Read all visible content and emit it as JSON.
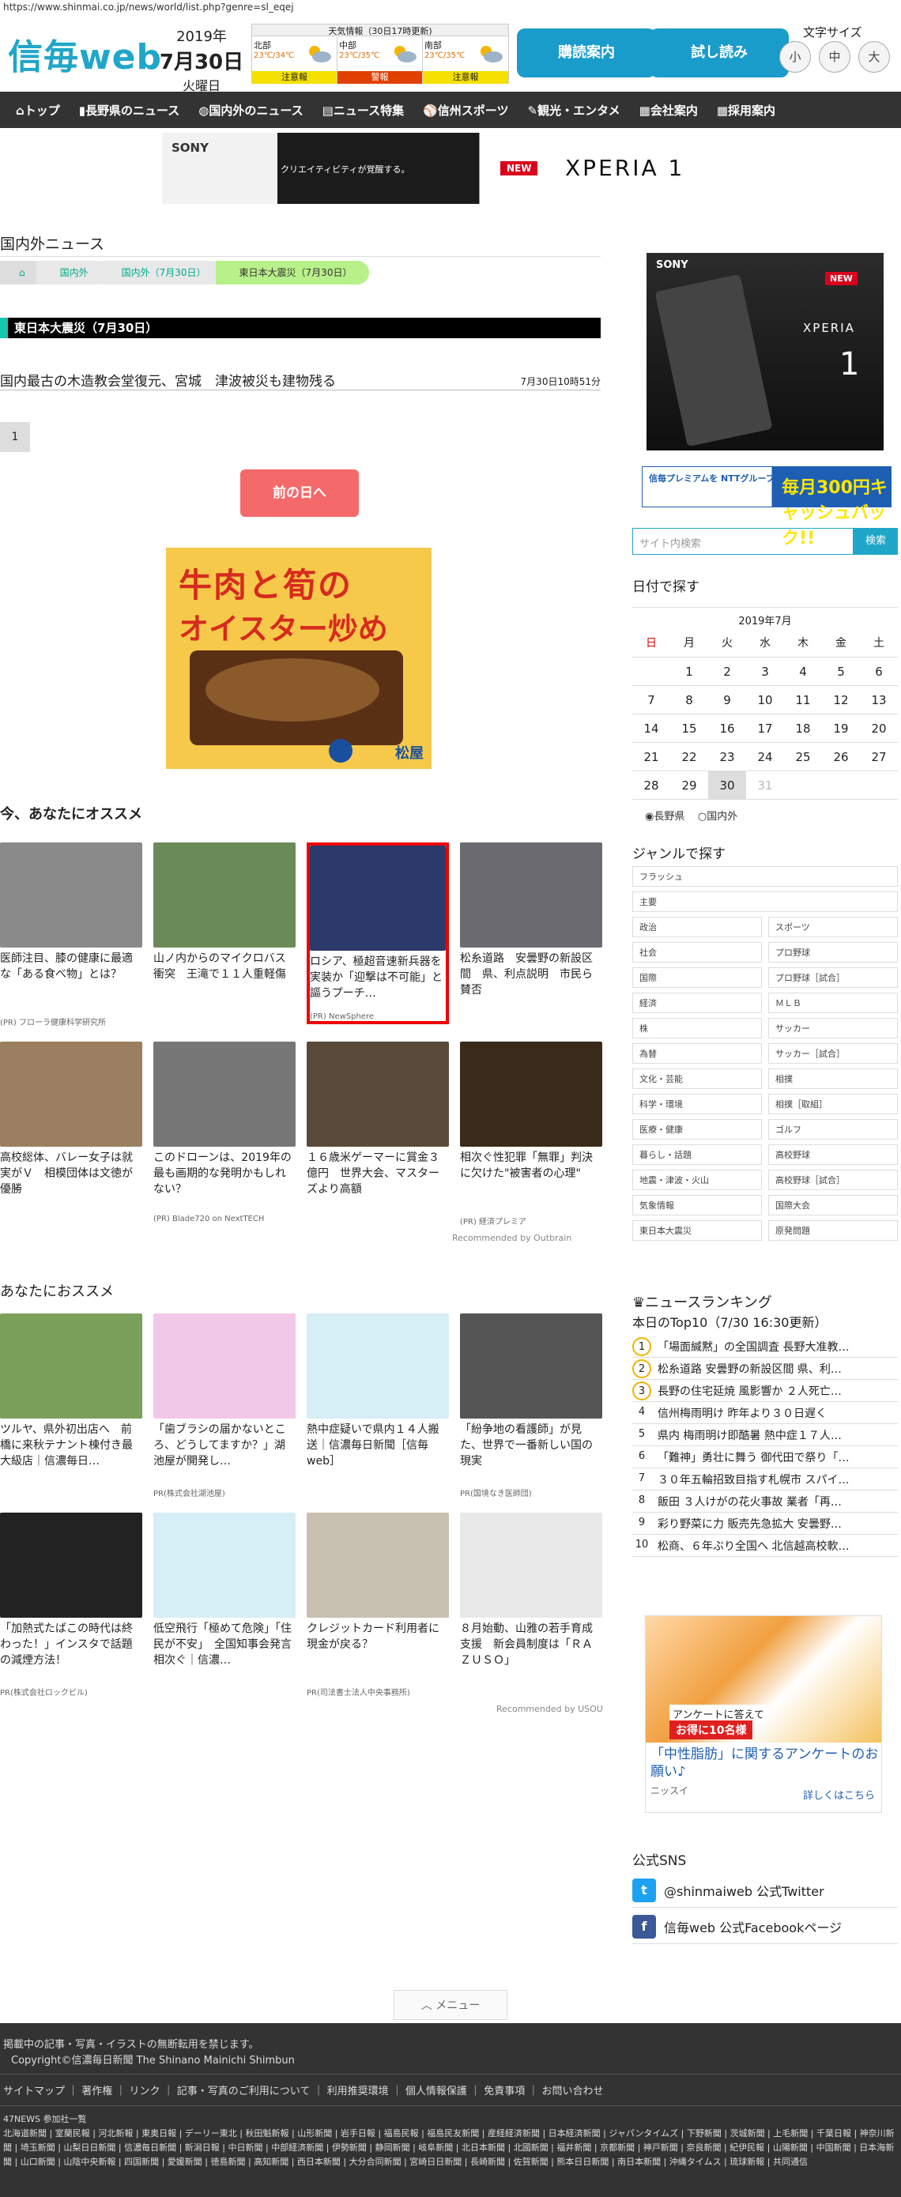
{
  "url": "https://www.shinmai.co.jp/news/world/list.php?genre=sl_eqej",
  "logo": "信毎web",
  "date": {
    "year": "2019年",
    "day": "7月30日",
    "weekday": "火曜日"
  },
  "weather": {
    "title": "天気情報（30日17時更新)",
    "regions": [
      {
        "name": "北部",
        "temp": "23℃/34℃",
        "warn": "注意報",
        "warn_color": "#f5e000"
      },
      {
        "name": "中部",
        "temp": "23℃/35℃",
        "warn": "警報",
        "warn_color": "#e04000"
      },
      {
        "name": "南部",
        "temp": "23℃/35℃",
        "warn": "注意報",
        "warn_color": "#f5e000"
      }
    ]
  },
  "header": {
    "subscribe": "購読案内",
    "trial": "試し読み",
    "font_size_label": "文字サイズ",
    "font_sizes": [
      "小",
      "中",
      "大"
    ]
  },
  "nav": [
    "トップ",
    "長野県のニュース",
    "国内外のニュース",
    "ニュース特集",
    "信州スポーツ",
    "観光・エンタメ",
    "会社案内",
    "採用案内"
  ],
  "top_ad": {
    "brand": "SONY",
    "copy": "クリエイティビティが覚醒する。",
    "badge": "NEW",
    "product": "XPERIA 1"
  },
  "main": {
    "section_title": "国内外ニュース",
    "breadcrumbs": [
      "国内外",
      "国内外（7月30日）",
      "東日本大震災（7月30日）"
    ],
    "date_band": "東日本大震災（7月30日）",
    "article": {
      "title": "国内最古の木造教会堂復元、宮城　津波被災も建物残る",
      "time": "7月30日10時51分"
    },
    "page": "1",
    "prev_day": "前の日へ"
  },
  "food_ad": {
    "line1": "牛肉と筍の",
    "line2": "オイスター炒め",
    "brand": "松屋"
  },
  "rec1": {
    "title": "今、あなたにオススメ",
    "credit": "Recommended by Outbrain",
    "items": [
      {
        "caption": "医師注目、膝の健康に最適な「ある食べ物」とは？",
        "source": "(PR) フローラ健康科学研究所",
        "color": "#8a8a8a"
      },
      {
        "caption": "山ノ内からのマイクロバス衝突　王滝で１１人重軽傷",
        "source": "",
        "color": "#6b8a5a"
      },
      {
        "caption": "ロシア、極超音速新兵器を実装か「迎撃は不可能」と謳うプーチ…",
        "source": "(PR) NewSphere",
        "color": "#2b3a6b"
      },
      {
        "caption": "松糸道路　安曇野の新設区間　県、利点説明　市民ら賛否",
        "source": "",
        "color": "#6a6a70"
      },
      {
        "caption": "高校総体、バレー女子は就実がＶ　相模団体は文徳が優勝",
        "source": "",
        "color": "#9a8060"
      },
      {
        "caption": "このドローンは、2019年の最も画期的な発明かもしれない？",
        "source": "(PR) Blade720 on NextTECH",
        "color": "#777"
      },
      {
        "caption": "１６歳米ゲーマーに賞金３億円　世界大会、マスターズより高額",
        "source": "",
        "color": "#5a4a3a"
      },
      {
        "caption": "相次ぐ性犯罪「無罪」判決に欠けた\"被害者の心理\"",
        "source": "(PR) 経済プレミア",
        "color": "#3a2a1a"
      }
    ]
  },
  "rec2": {
    "title": "あなたにおススメ",
    "credit": "Recommended by USOU",
    "items": [
      {
        "caption": "ツルヤ、県外初出店へ　前橋に来秋テナント棟付き最大級店｜信濃毎日…",
        "source": "",
        "color": "#7aa05a"
      },
      {
        "caption": "「歯ブラシの届かないところ、どうしてますか？」湖池屋が開発し…",
        "source": "PR(株式会社湖池屋)",
        "color": "#f2c8e8"
      },
      {
        "caption": "熱中症疑いで県内１４人搬送｜信濃毎日新聞［信毎web］",
        "source": "",
        "color": "#d6eef5"
      },
      {
        "caption": "「紛争地の看護師」が見た、世界で一番新しい国の現実",
        "source": "PR(国境なき医師団)",
        "color": "#555"
      },
      {
        "caption": "「加熱式たばこの時代は終わった！」インスタで話題の減煙方法！",
        "source": "PR(株式会社ロックビル)",
        "color": "#222"
      },
      {
        "caption": "低空飛行「極めて危険」「住民が不安」　全国知事会発言相次ぐ｜信濃…",
        "source": "",
        "color": "#d6eef5"
      },
      {
        "caption": "クレジットカード利用者に現金が戻る？",
        "source": "PR(司法書士法人中央事務所)",
        "color": "#c8c0b0"
      },
      {
        "caption": "８月始動、山雅の若手育成支援　新会員制度は「ＲＡＺＵＳＯ」",
        "source": "",
        "color": "#e8e8e8"
      }
    ]
  },
  "sidebar": {
    "ad": {
      "brand": "SONY",
      "badge": "NEW",
      "product": "XPERIA",
      "num": "1"
    },
    "premium": {
      "left": "信毎プレミアムを NTTグループカードで お支払いすると",
      "right": "毎月300円キャッシュバック!!"
    },
    "search_placeholder": "サイト内検索",
    "search_button": "検索",
    "calendar_title": "日付で探す",
    "calendar_month": "2019年7月",
    "weekdays": [
      "日",
      "月",
      "火",
      "水",
      "木",
      "金",
      "土"
    ],
    "days": [
      "",
      "1",
      "2",
      "3",
      "4",
      "5",
      "6",
      "7",
      "8",
      "9",
      "10",
      "11",
      "12",
      "13",
      "14",
      "15",
      "16",
      "17",
      "18",
      "19",
      "20",
      "21",
      "22",
      "23",
      "24",
      "25",
      "26",
      "27",
      "28",
      "29",
      "30",
      "31",
      "",
      "",
      ""
    ],
    "radio": [
      "長野県",
      "国内外"
    ],
    "genre_title": "ジャンルで探す",
    "genres_full": [
      "フラッシュ",
      "主要"
    ],
    "genres": [
      "政治",
      "スポーツ",
      "社会",
      "プロ野球",
      "国際",
      "プロ野球［試合］",
      "経済",
      "ＭＬＢ",
      "株",
      "サッカー",
      "為替",
      "サッカー［試合］",
      "文化・芸能",
      "相撲",
      "科学・環境",
      "相撲［取組］",
      "医療・健康",
      "ゴルフ",
      "暮らし・話題",
      "高校野球",
      "地震・津波・火山",
      "高校野球［試合］",
      "気象情報",
      "国際大会",
      "東日本大震災",
      "原発問題"
    ],
    "ranking_title": "ニュースランキング",
    "ranking_sub": "本日のTop10（7/30 16:30更新）",
    "ranking": [
      "「場面緘黙」の全国調査 長野大准教…",
      "松糸道路 安曇野の新設区間 県、利…",
      "長野の住宅延焼 風影響か ２人死亡…",
      "信州梅雨明け 昨年より３０日遅く",
      "県内 梅雨明け即酷暑 熱中症１７人…",
      "「難神」勇壮に舞う 御代田で祭り「…",
      "３０年五輪招致目指す札幌市 スパイ…",
      "飯田 ３人けがの花火事故 業者「再…",
      "彩り野菜に力 販売先急拡大 安曇野…",
      "松商、６年ぶり全国へ 北信越高校軟…"
    ],
    "anketo": {
      "mini": "アンケートに答えて",
      "badge": "お得に10名様",
      "headline": "「中性脂肪」に関するアンケートのお願い♪",
      "sponsor": "ニッスイ",
      "link": "詳しくはこちら"
    },
    "sns_title": "公式SNS",
    "twitter": "@shinmaiweb 公式Twitter",
    "facebook": "信毎web 公式Facebookページ"
  },
  "menu": "メニュー",
  "footer": {
    "notice": "掲載中の記事・写真・イラストの無断転用を禁じます。",
    "copyright": "Copyright©信濃毎日新聞 The Shinano Mainichi Shimbun",
    "links": "サイトマップ ｜ 著作権 ｜ リンク ｜ 記事・写真のご利用について ｜ 利用推奨環境 ｜ 個人情報保護 ｜ 免責事項 ｜ お問い合わせ",
    "members": "47NEWS 参加社一覧\n北海道新聞 | 室蘭民報 | 河北新報 | 東奥日報 | デーリー東北 | 秋田魁新報 | 山形新聞 | 岩手日報 | 福島民報 | 福島民友新聞 | 産経経済新聞 | 日本経済新聞 | ジャパンタイムズ | 下野新聞 | 茨城新聞 | 上毛新聞 | 千葉日報 | 神奈川新聞 | 埼玉新聞 | 山梨日日新聞 | 信濃毎日新聞 | 新潟日報 | 中日新聞 | 中部経済新聞 | 伊勢新聞 | 静岡新聞 | 岐阜新聞 | 北日本新聞 | 北國新聞 | 福井新聞 | 京都新聞 | 神戸新聞 | 奈良新聞 | 紀伊民報 | 山陽新聞 | 中国新聞 | 日本海新聞 | 山口新聞 | 山陰中央新報 | 四国新聞 | 愛媛新聞 | 徳島新聞 | 高知新聞 | 西日本新聞 | 大分合同新聞 | 宮崎日日新聞 | 長崎新聞 | 佐賀新聞 | 熊本日日新聞 | 南日本新聞 | 沖縄タイムス | 琉球新報 | 共同通信"
  }
}
